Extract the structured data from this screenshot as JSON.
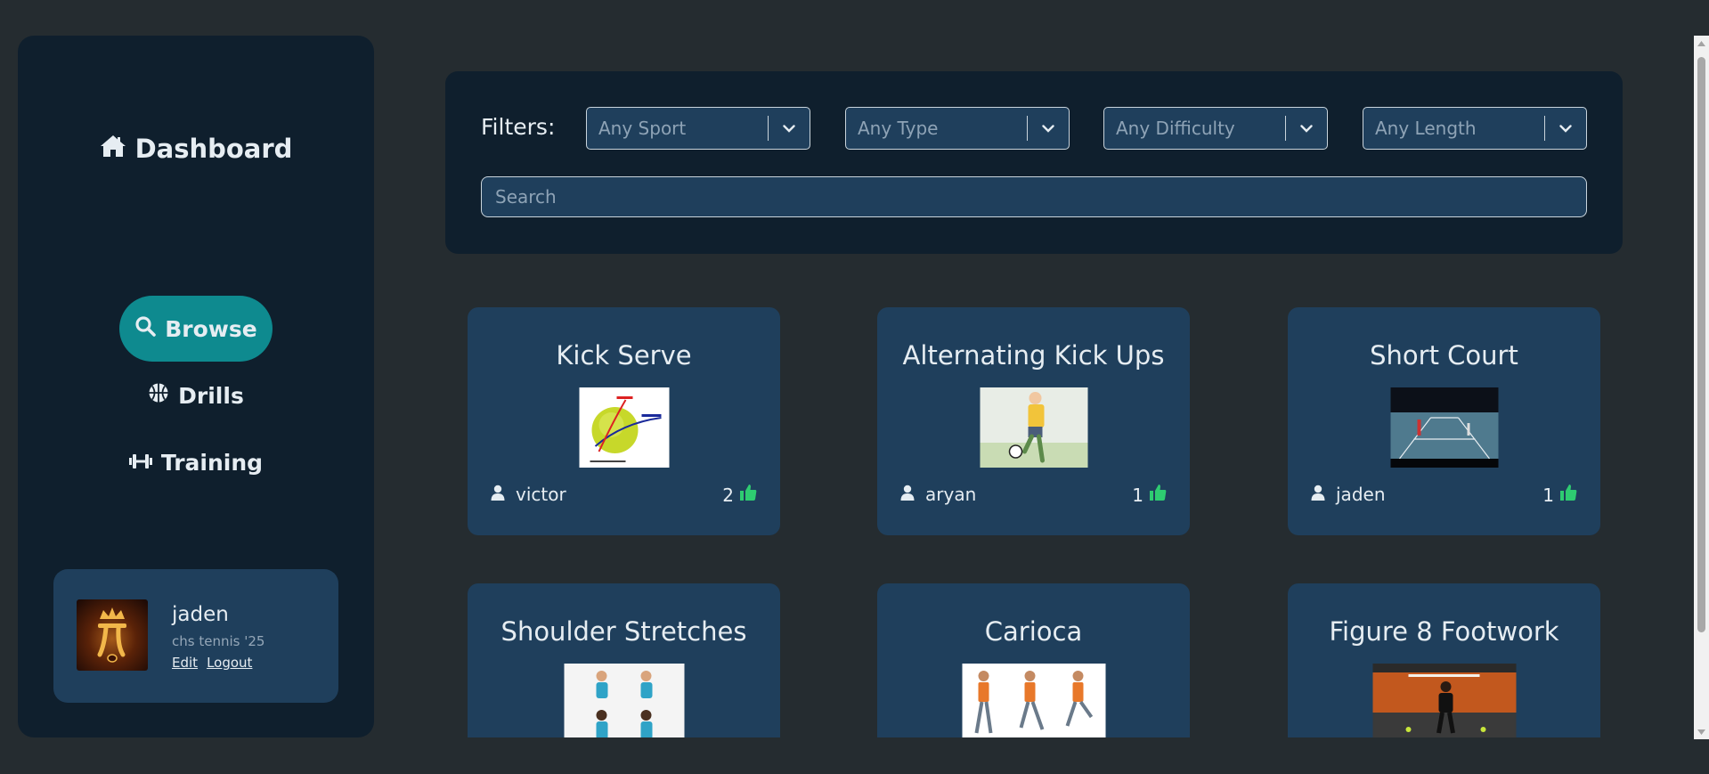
{
  "sidebar": {
    "title": "Dashboard",
    "nav": [
      {
        "label": "Browse",
        "icon": "search-icon",
        "active": true
      },
      {
        "label": "Drills",
        "icon": "basketball-icon",
        "active": false
      },
      {
        "label": "Training",
        "icon": "dumbbell-icon",
        "active": false
      }
    ],
    "profile": {
      "name": "jaden",
      "subtitle": "chs tennis '25",
      "edit": "Edit",
      "logout": "Logout"
    }
  },
  "filters": {
    "label": "Filters:",
    "selects": [
      {
        "value": "Any Sport"
      },
      {
        "value": "Any Type"
      },
      {
        "value": "Any Difficulty"
      },
      {
        "value": "Any Length"
      }
    ],
    "search_placeholder": "Search"
  },
  "cards": [
    {
      "title": "Kick Serve",
      "author": "victor",
      "likes": "2"
    },
    {
      "title": "Alternating Kick Ups",
      "author": "aryan",
      "likes": "1"
    },
    {
      "title": "Short Court",
      "author": "jaden",
      "likes": "1"
    },
    {
      "title": "Shoulder Stretches",
      "author": "",
      "likes": ""
    },
    {
      "title": "Carioca",
      "author": "",
      "likes": ""
    },
    {
      "title": "Figure 8 Footwork",
      "author": "",
      "likes": ""
    }
  ],
  "colors": {
    "background": "#252c30",
    "panel": "#0f1f2d",
    "card": "#1f3f5c",
    "accent": "#0e8a8f",
    "like": "#2ecc71"
  }
}
